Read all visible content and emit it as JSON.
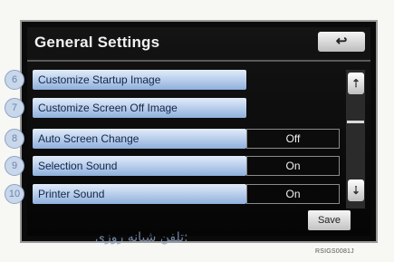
{
  "header": {
    "title": "General Settings",
    "back_icon": "↩"
  },
  "rows": [
    {
      "number": "6",
      "label": "Customize Startup Image",
      "value": ""
    },
    {
      "number": "7",
      "label": "Customize Screen Off Image",
      "value": ""
    },
    {
      "number": "8",
      "label": "Auto Screen Change",
      "value": "Off"
    },
    {
      "number": "9",
      "label": "Selection Sound",
      "value": "On"
    },
    {
      "number": "10",
      "label": "Printer Sound",
      "value": "On"
    }
  ],
  "scroll": {
    "up_icon": "⇡",
    "down_icon": "⇣"
  },
  "footer": {
    "save_label": "Save"
  },
  "watermark": "تلفن شبانه روزی:",
  "image_code": "RSIGS0081J",
  "colors": {
    "button_top": "#e2ecfa",
    "button_bottom": "#8fb0dc",
    "screen": "#050505"
  }
}
